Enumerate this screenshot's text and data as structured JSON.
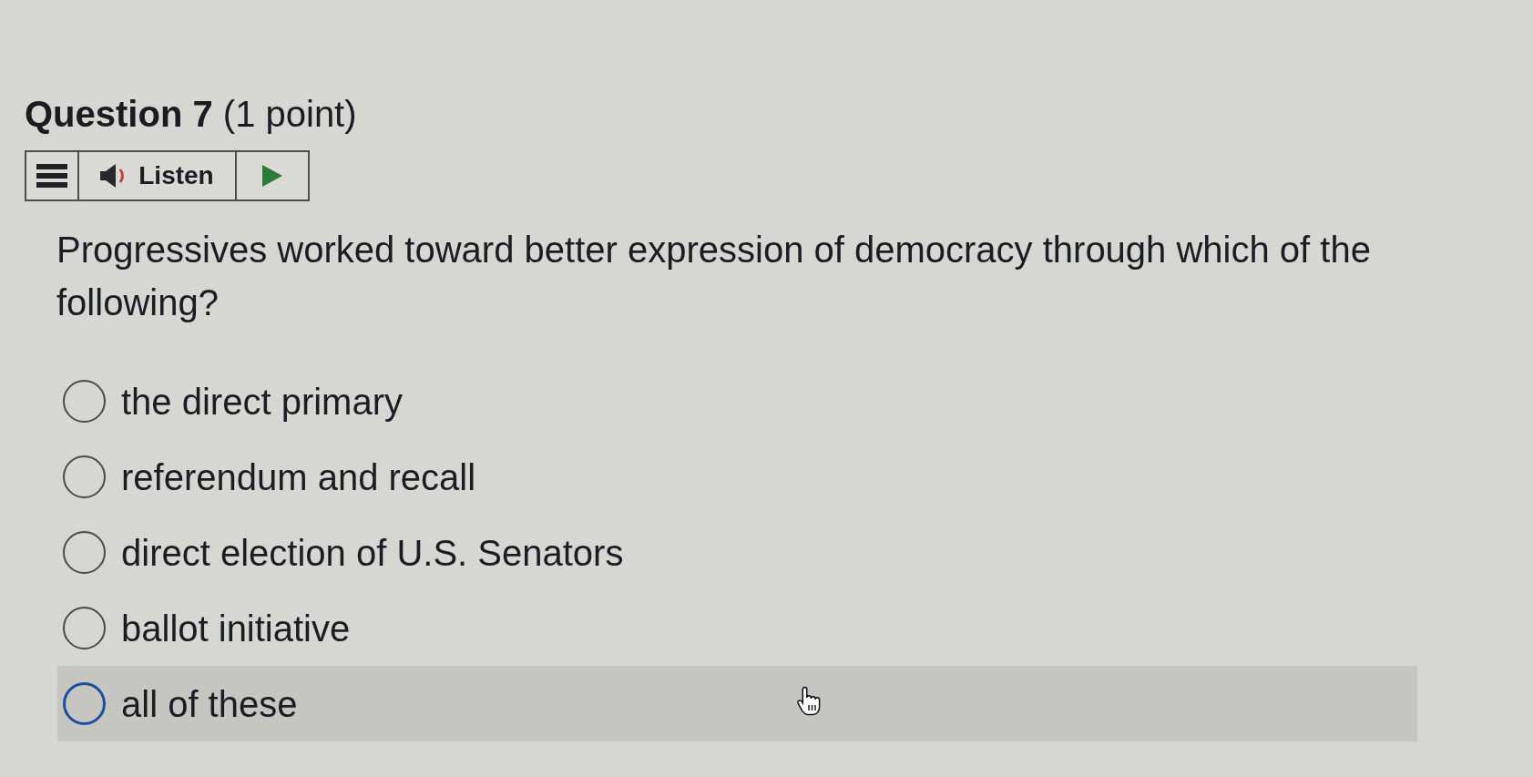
{
  "question": {
    "title": "**Question 7** (1 point)",
    "listen_bar": {
      "label": "Listen"
    },
    "prompt": "Progressives worked toward better expression of democracy through which of the following?",
    "options": [
      {
        "label": "the direct primary",
        "selected": false,
        "hovered": false
      },
      {
        "label": "referendum and recall",
        "selected": false,
        "hovered": false
      },
      {
        "label": "direct election of U.S. Senators",
        "selected": false,
        "hovered": false
      },
      {
        "label": "ballot initiative",
        "selected": false,
        "hovered": false
      },
      {
        "label": "all of these",
        "selected": false,
        "hovered": true
      }
    ]
  }
}
